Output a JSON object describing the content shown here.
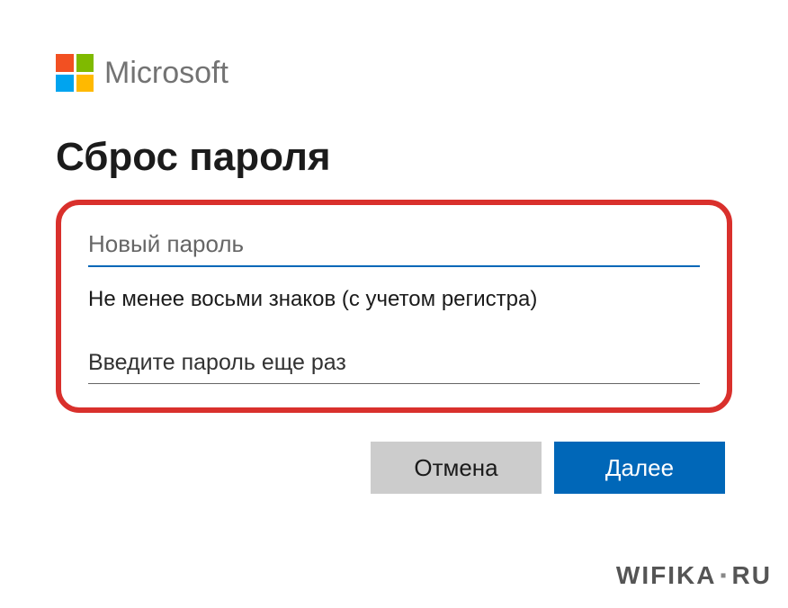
{
  "brand": {
    "name": "Microsoft",
    "colors": {
      "red": "#f25022",
      "green": "#7fba00",
      "blue": "#00a4ef",
      "yellow": "#ffb900"
    }
  },
  "page": {
    "title": "Сброс пароля"
  },
  "form": {
    "new_password": {
      "placeholder": "Новый пароль",
      "value": ""
    },
    "hint": "Не менее восьми знаков (с учетом регистра)",
    "confirm_password": {
      "placeholder": "Введите пароль еще раз",
      "value": ""
    }
  },
  "buttons": {
    "cancel": "Отмена",
    "next": "Далее"
  },
  "watermark": {
    "part1": "WIFIKA",
    "part2": "RU"
  },
  "colors": {
    "accent": "#0067b8",
    "highlight_border": "#d9302c",
    "button_secondary": "#cccccc"
  }
}
